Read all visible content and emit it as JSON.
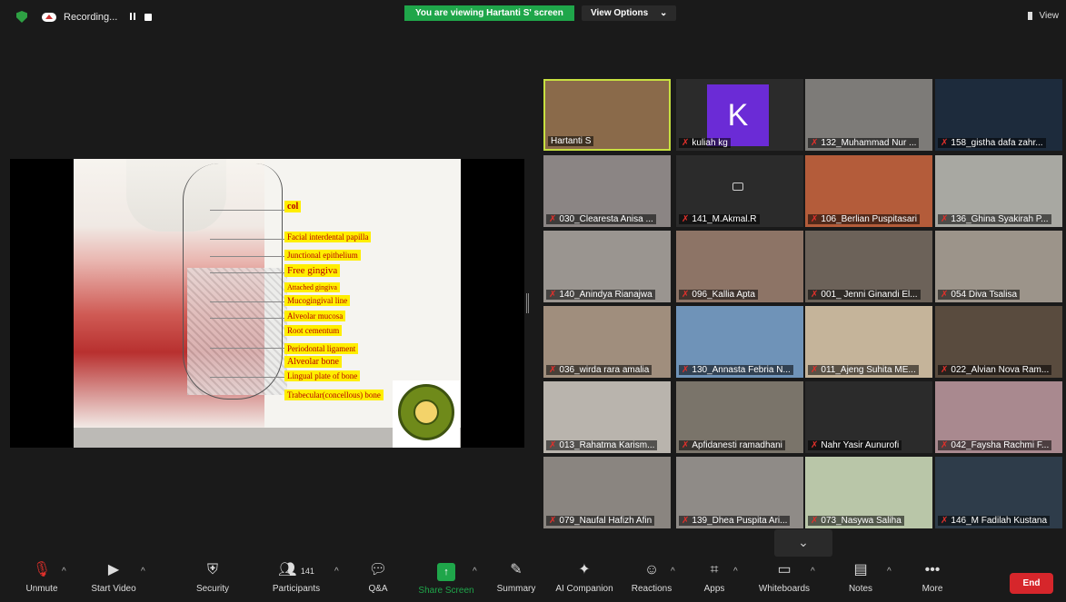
{
  "topbar": {
    "recording_label": "Recording...",
    "viewing_banner": "You are viewing Hartanti S' screen",
    "view_options": "View Options",
    "view_label": "View"
  },
  "slide": {
    "labels": [
      "col",
      "Facial interdental papilla",
      "Junctional epithelium",
      "Free gingiva",
      "Attached gingiva",
      "Mucogingival line",
      "Alveolar mucosa",
      "Root cementum",
      "Periodontal ligament",
      "Alveolar bone",
      "Lingual plate of bone",
      "Trabecular(concellous) bone"
    ],
    "logo_text": "UNIVERSITAS MUHAMMADIYAH YOGYAKARTA"
  },
  "participants": [
    {
      "name": "Hartanti S",
      "muted": false,
      "color": "#8a6a4a"
    },
    {
      "name": "kuliah kg",
      "muted": true,
      "avatar": "K",
      "color": "#2b2b2b"
    },
    {
      "name": "132_Muhammad Nur ...",
      "muted": true,
      "color": "#7d7b78"
    },
    {
      "name": "158_gistha dafa zahr...",
      "muted": true,
      "color": "#1d2b3c"
    },
    {
      "name": "030_Clearesta Anisa ...",
      "muted": true,
      "color": "#8b8584"
    },
    {
      "name": "141_M.Akmal.R",
      "muted": true,
      "cam_off": true,
      "color": "#2b2b2b"
    },
    {
      "name": "106_Berlian Puspitasari",
      "muted": true,
      "color": "#b45c3a"
    },
    {
      "name": "136_Ghina Syakirah P...",
      "muted": true,
      "color": "#a8a8a2"
    },
    {
      "name": "140_Anindya Rianajwa",
      "muted": true,
      "color": "#9a9590"
    },
    {
      "name": "096_Kallia Apta",
      "muted": true,
      "color": "#8d7466"
    },
    {
      "name": "001_ Jenni Ginandi El...",
      "muted": true,
      "color": "#6c6259"
    },
    {
      "name": "054 Diva Tsalisa",
      "muted": true,
      "color": "#9c948a"
    },
    {
      "name": "036_wirda rara amalia",
      "muted": true,
      "color": "#a08e7d"
    },
    {
      "name": "130_Annasta Febria N...",
      "muted": true,
      "color": "#6f93b8"
    },
    {
      "name": "011_Ajeng Suhita ME...",
      "muted": true,
      "color": "#c5b49a"
    },
    {
      "name": "022_Alvian Nova Ram...",
      "muted": true,
      "color": "#594b3e"
    },
    {
      "name": "013_Rahatma Karism...",
      "muted": true,
      "color": "#b9b4ad"
    },
    {
      "name": "Apfidanesti ramadhani",
      "muted": true,
      "color": "#7a746a"
    },
    {
      "name": "Nahr Yasir Aunurofi",
      "muted": true,
      "color": "#2b2b2b"
    },
    {
      "name": "042_Faysha Rachmi F...",
      "muted": true,
      "color": "#a9898f"
    },
    {
      "name": "079_Naufal Hafizh Afin",
      "muted": true,
      "color": "#8a8580"
    },
    {
      "name": "139_Dhea Puspita Ari...",
      "muted": true,
      "color": "#8f8b87"
    },
    {
      "name": "073_Nasywa Saliha",
      "muted": true,
      "color": "#b9c6a8"
    },
    {
      "name": "146_M Fadilah Kustana",
      "muted": true,
      "color": "#2e3c4a"
    }
  ],
  "toolbar": {
    "unmute": "Unmute",
    "start_video": "Start Video",
    "security": "Security",
    "participants": "Participants",
    "participant_count": "141",
    "qa": "Q&A",
    "share_screen": "Share Screen",
    "summary": "Summary",
    "ai_companion": "AI Companion",
    "reactions": "Reactions",
    "apps": "Apps",
    "whiteboards": "Whiteboards",
    "notes": "Notes",
    "more": "More",
    "end": "End"
  },
  "colors": {
    "accent_green": "#1fa64a",
    "end_red": "#d6262b",
    "active_speaker": "#c7e040"
  }
}
